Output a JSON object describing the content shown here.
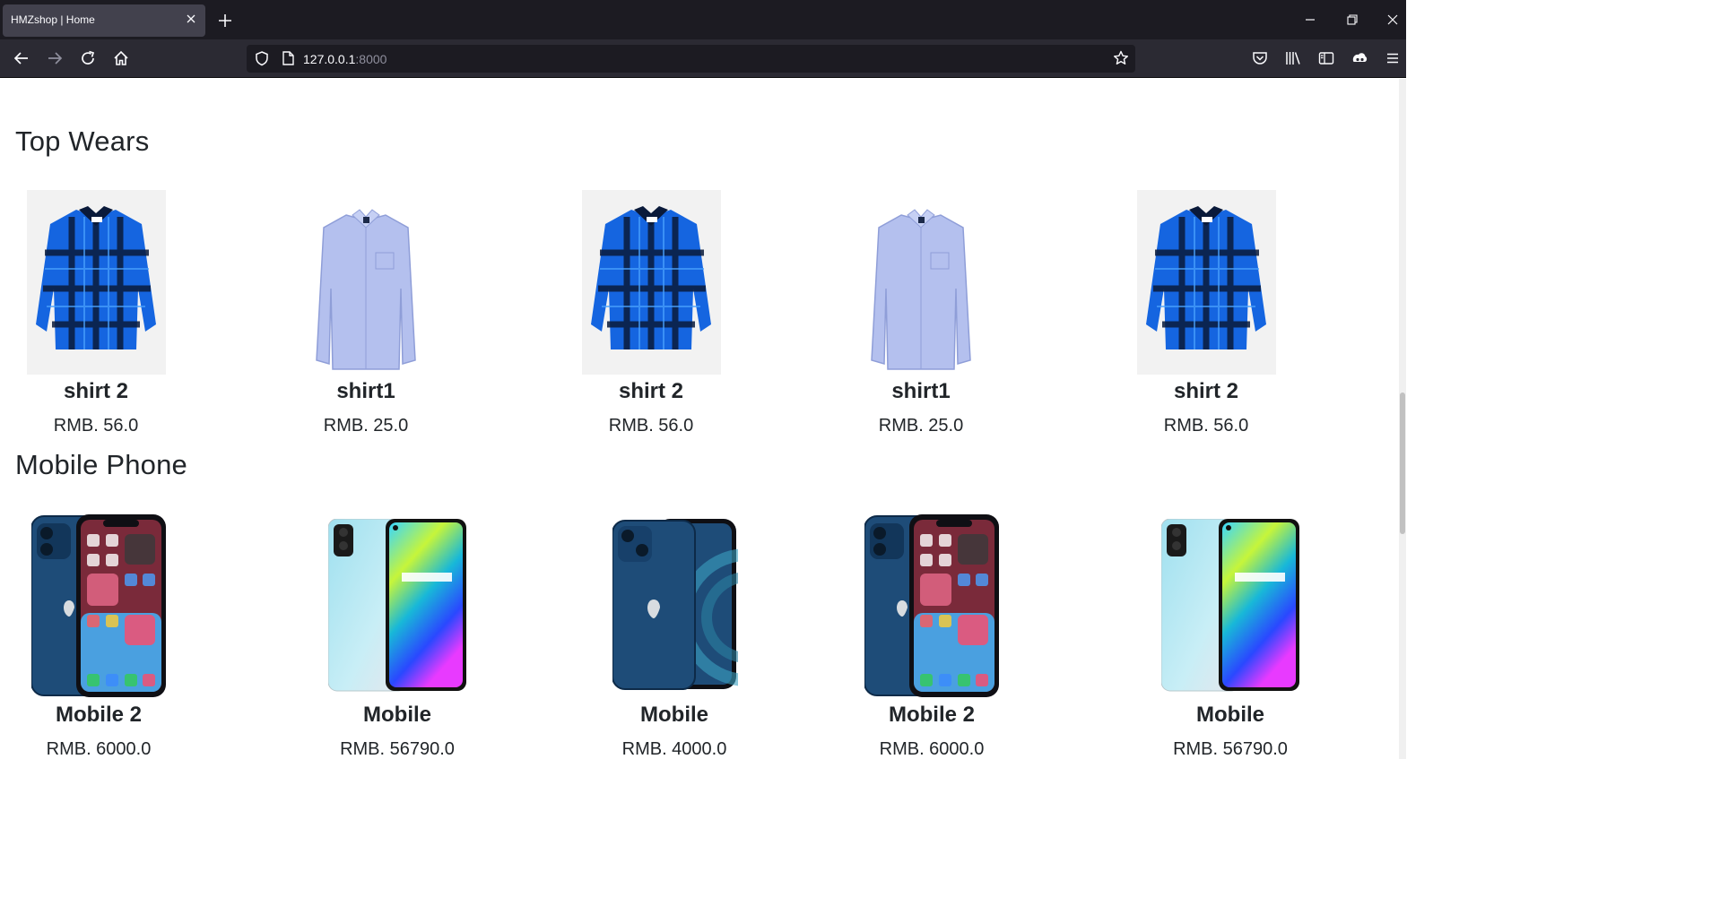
{
  "browser": {
    "tab_title": "HMZshop | Home",
    "url_host": "127.0.0.1",
    "url_port": ":8000"
  },
  "sections": [
    {
      "title": "Top Wears",
      "products": [
        {
          "name": "shirt 2",
          "price": "RMB. 56.0"
        },
        {
          "name": "shirt1",
          "price": "RMB. 25.0"
        },
        {
          "name": "shirt 2",
          "price": "RMB. 56.0"
        },
        {
          "name": "shirt1",
          "price": "RMB. 25.0"
        },
        {
          "name": "shirt 2",
          "price": "RMB. 56.0"
        }
      ]
    },
    {
      "title": "Mobile Phone",
      "products": [
        {
          "name": "Mobile 2",
          "price": "RMB. 6000.0"
        },
        {
          "name": "Mobile",
          "price": "RMB. 56790.0"
        },
        {
          "name": "Mobile",
          "price": "RMB. 4000.0"
        },
        {
          "name": "Mobile 2",
          "price": "RMB. 6000.0"
        },
        {
          "name": "Mobile",
          "price": "RMB. 56790.0"
        }
      ]
    }
  ],
  "colors": {
    "plaid_blue": "#1565e0",
    "plaid_dark": "#0a1a3a",
    "light_shirt": "#b4c0ee",
    "iphone_blue": "#1e4c78",
    "realme_cyan": "#9fe0ef"
  }
}
